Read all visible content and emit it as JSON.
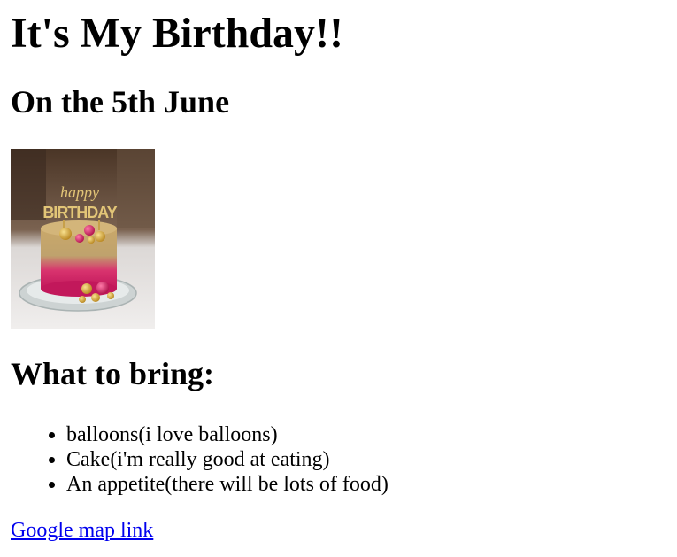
{
  "page": {
    "heading": "It's My Birthday!!",
    "date_heading": "On the 5th June",
    "image": {
      "description": "birthday-cake-photo",
      "topper_text": "happy BIRTHDAY",
      "colors": {
        "background_dark": "#5a4330",
        "background_light": "#e8e4e2",
        "cake_gold": "#c9a86a",
        "cake_pink": "#d8336e",
        "ball_gold": "#d4a93a",
        "plate_glass": "#d9dede"
      }
    },
    "bring_heading": "What to bring:",
    "bring_items": [
      "balloons(i love balloons)",
      "Cake(i'm really good at eating)",
      "An appetite(there will be lots of food)"
    ],
    "map_link_text": "Google map link",
    "link_color": "#0000ee"
  }
}
